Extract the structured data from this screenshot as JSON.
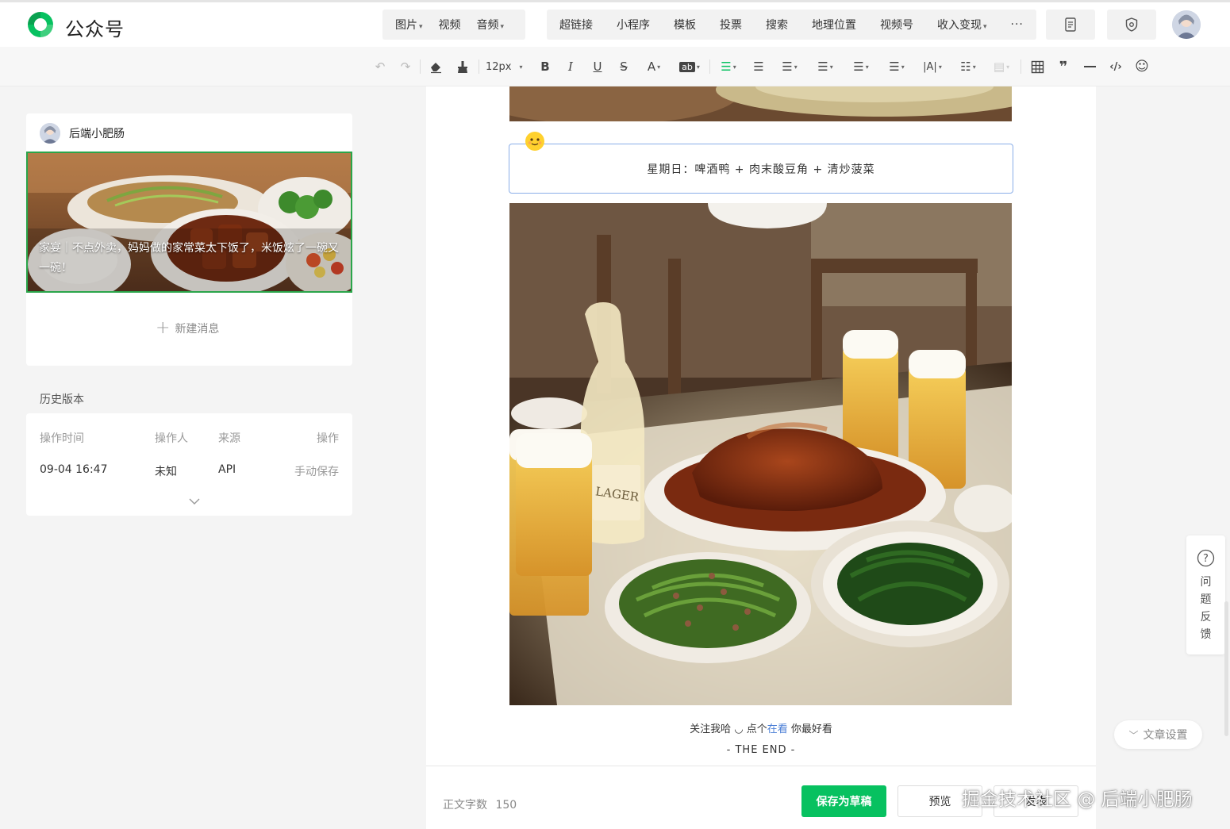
{
  "header": {
    "brand": "公众号",
    "insert_group1": [
      {
        "label": "图片",
        "caret": true
      },
      {
        "label": "视频",
        "caret": false
      },
      {
        "label": "音频",
        "caret": true
      }
    ],
    "insert_group2": [
      {
        "label": "超链接",
        "caret": false
      },
      {
        "label": "小程序",
        "caret": false
      },
      {
        "label": "模板",
        "caret": false
      },
      {
        "label": "投票",
        "caret": false
      },
      {
        "label": "搜索",
        "caret": false
      },
      {
        "label": "地理位置",
        "caret": false
      },
      {
        "label": "视频号",
        "caret": false
      },
      {
        "label": "收入变现",
        "caret": true
      }
    ],
    "more": "···"
  },
  "toolbar": {
    "font_size": "12px"
  },
  "sidebar": {
    "account_name": "后端小肥肠",
    "cover_title": "家宴｜不点外卖，妈妈做的家常菜太下饭了，米饭炫了一碗又一碗！",
    "new_message": "新建消息",
    "new_message_icon": "+"
  },
  "history": {
    "title": "历史版本",
    "headers": {
      "time": "操作时间",
      "operator": "操作人",
      "source": "来源",
      "action": "操作"
    },
    "rows": [
      {
        "time": "09-04 16:47",
        "operator": "未知",
        "source": "API",
        "action": "手动保存"
      }
    ]
  },
  "editor": {
    "callout": "星期日：啤酒鸭 + 肉末酸豆角 + 清炒菠菜",
    "follow_prefix": "关注我哈 ◡ 点个",
    "follow_link": "在看",
    "follow_suffix": " 你最好看",
    "the_end": "- THE END -"
  },
  "bottom": {
    "word_count_label": "正文字数",
    "word_count": "150",
    "save_draft": "保存为草稿",
    "preview": "预览",
    "publish": "发表"
  },
  "float": {
    "feedback_label": "问题反馈",
    "feedback_icon": "?",
    "article_settings": "文章设置",
    "article_settings_icon": "﹀"
  },
  "watermark": "掘金技术社区 @ 后端小肥肠",
  "colors": {
    "accent_green": "#07c160",
    "selected_border": "#2aa54a",
    "link_blue": "#4a7ed6",
    "callout_border": "#8aaee8"
  }
}
